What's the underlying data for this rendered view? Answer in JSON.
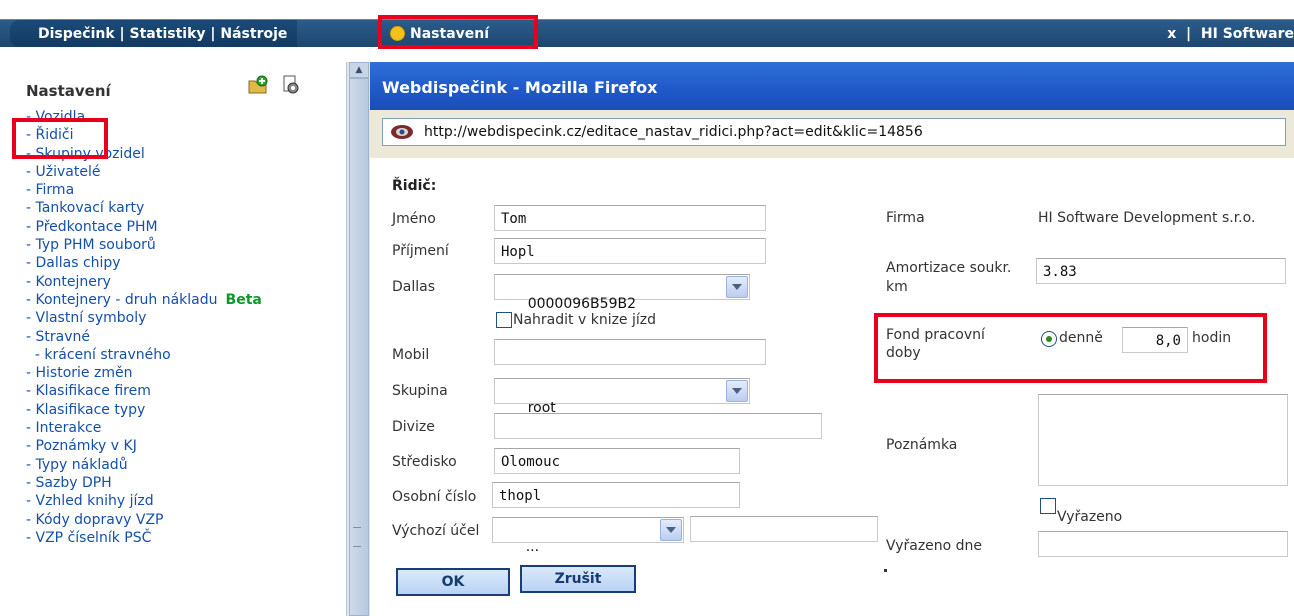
{
  "nav": {
    "dispecink": "Dispečink",
    "sep1": " | ",
    "statistiky": "Statistiky",
    "sep2": " | ",
    "nastroje": "Nástroje",
    "nastaveni": "Nastavení",
    "right_text": "x  |  HI Software"
  },
  "sidebar": {
    "title": "Nastavení",
    "items": [
      "- Vozidla",
      "- Řidiči",
      "- Skupiny vozidel",
      "- Uživatelé",
      "- Firma",
      "- Tankovací karty",
      "- Předkontace PHM",
      "- Typ PHM souborů",
      "- Dallas chipy",
      "- Kontejnery",
      "- Kontejnery - druh nákladu",
      "- Vlastní symboly",
      "- Stravné",
      "  - krácení stravného",
      "- Historie změn",
      "- Klasifikace firem",
      "- Klasifikace typy",
      "- Interakce",
      "- Poznámky v KJ",
      "- Typy nákladů",
      "- Sazby DPH",
      "- Vzhled knihy jízd",
      "- Kódy dopravy VZP",
      "- VZP číselník PSČ"
    ],
    "beta_label": "Beta"
  },
  "popup": {
    "title": "Webdispečink - Mozilla Firefox",
    "url": "http://webdispecink.cz/editace_nastav_ridici.php?act=edit&klic=14856"
  },
  "form": {
    "heading": "Řidič:",
    "jmeno_label": "Jméno",
    "jmeno_value": "Tom",
    "prijmeni_label": "Příjmení",
    "prijmeni_value": "Hopl",
    "dallas_label": "Dallas",
    "dallas_value": "0000096B59B2",
    "nahradit_label": "Nahradit v knize jízd",
    "mobil_label": "Mobil",
    "mobil_value": "",
    "skupina_label": "Skupina",
    "skupina_value": "root",
    "divize_label": "Divize",
    "divize_value": "",
    "stredisko_label": "Středisko",
    "stredisko_value": "Olomouc",
    "osobni_label": "Osobní číslo",
    "osobni_value": "thopl",
    "vychozi_label": "Výchozí účel",
    "vychozi_value": "...",
    "vychozi_extra": "",
    "firma_label": "Firma",
    "firma_value": "HI Software Development s.r.o.",
    "amortizace_label_1": "Amortizace soukr.",
    "amortizace_label_2": "km",
    "amortizace_value": "3.83",
    "fond_label_1": "Fond pracovní",
    "fond_label_2": "doby",
    "denne_label": "denně",
    "fond_value": "8,0",
    "hodin_label": "hodin",
    "poznamka_label": "Poznámka",
    "vyrazeno_label": "Vyřazeno",
    "vyrazeno_dne_label": "Vyřazeno dne",
    "ok_label": "OK",
    "zrusit_label": "Zrušit"
  },
  "colors": {
    "nav_bg": "#1d4670",
    "link": "#1550a8",
    "beta": "#0a9a2a",
    "highlight": "#e8001c",
    "titlebar": "#1f58c8"
  }
}
